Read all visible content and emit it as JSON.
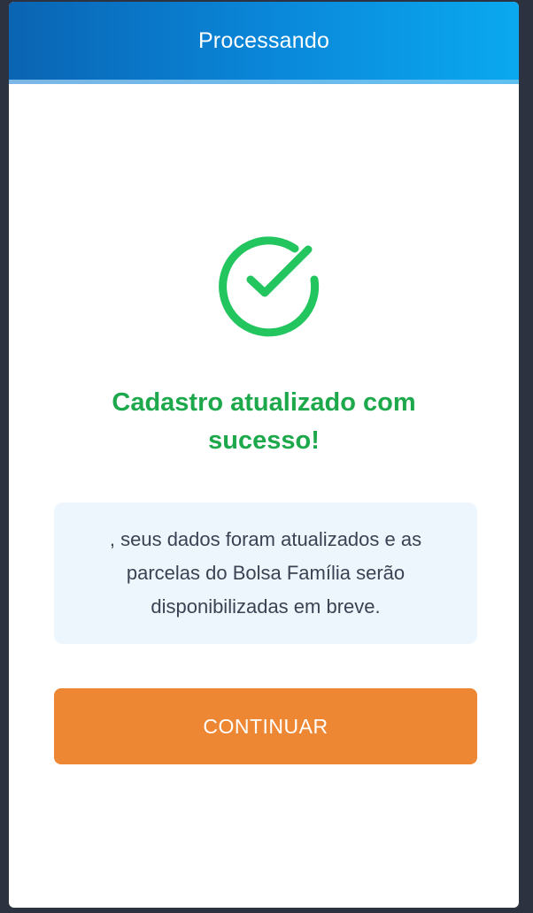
{
  "modal": {
    "title": "Processando",
    "status_icon": "check-circle-icon",
    "success_title": "Cadastro atualizado com sucesso!",
    "message": ", seus dados foram atualizados e as parcelas do Bolsa Família serão disponibilizadas em breve.",
    "continue_label": "CONTINUAR"
  },
  "colors": {
    "header_gradient_start": "#0a64b3",
    "header_gradient_end": "#0aa9ef",
    "success_green": "#1ea84c",
    "button_orange": "#ee8733",
    "message_background": "#eef6fd",
    "backdrop": "#2d3240"
  }
}
